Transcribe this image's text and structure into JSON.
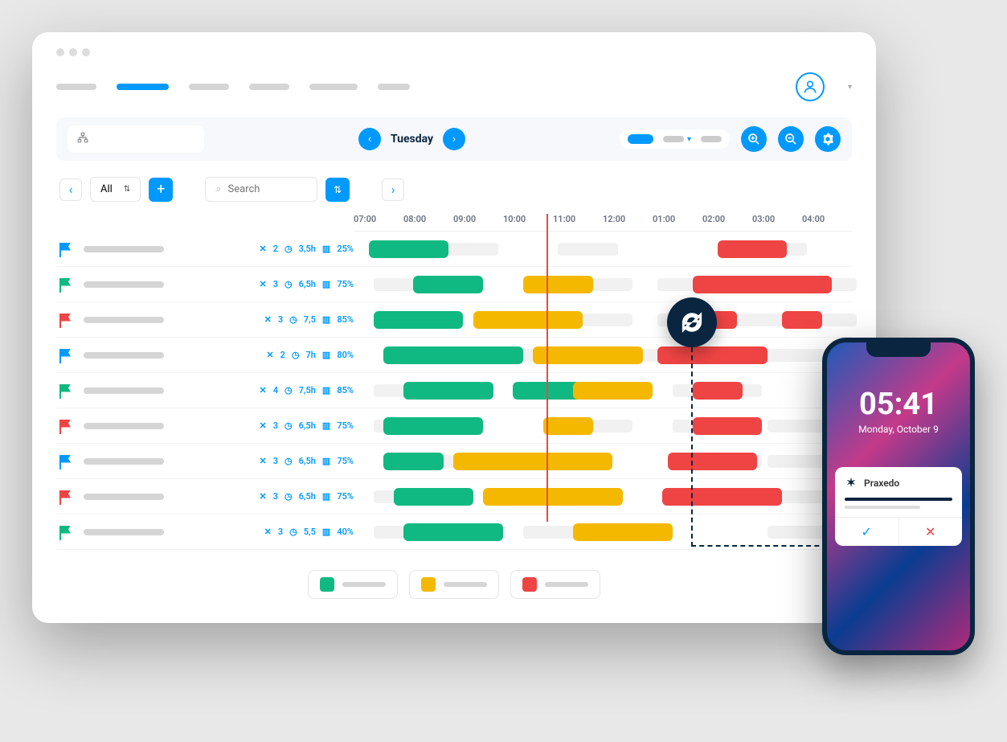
{
  "toolbar": {
    "day": "Tuesday"
  },
  "controls": {
    "filter": "All",
    "search_ph": "Search"
  },
  "times": [
    "07:00",
    "08:00",
    "09:00",
    "10:00",
    "11:00",
    "12:00",
    "01:00",
    "02:00",
    "03:00",
    "04:00"
  ],
  "rows": [
    {
      "flag": "blue",
      "tools": 2,
      "hrs": "3,5h",
      "pct": "25%"
    },
    {
      "flag": "green",
      "tools": 3,
      "hrs": "6,5h",
      "pct": "75%"
    },
    {
      "flag": "red",
      "tools": 3,
      "hrs": "7,5",
      "pct": "85%"
    },
    {
      "flag": "blue",
      "tools": 2,
      "hrs": "7h",
      "pct": "80%"
    },
    {
      "flag": "green",
      "tools": 4,
      "hrs": "7,5h",
      "pct": "85%"
    },
    {
      "flag": "red",
      "tools": 3,
      "hrs": "6,5h",
      "pct": "75%"
    },
    {
      "flag": "blue",
      "tools": 3,
      "hrs": "6,5h",
      "pct": "75%"
    },
    {
      "flag": "red",
      "tools": 3,
      "hrs": "6,5h",
      "pct": "75%"
    },
    {
      "flag": "green",
      "tools": 3,
      "hrs": "5,5",
      "pct": "40%"
    }
  ],
  "phone": {
    "time": "05:41",
    "date": "Monday, October 9",
    "notif_title": "Praxedo"
  },
  "colors": {
    "green": "#10b981",
    "yellow": "#f5b800",
    "red": "#ef4444"
  }
}
